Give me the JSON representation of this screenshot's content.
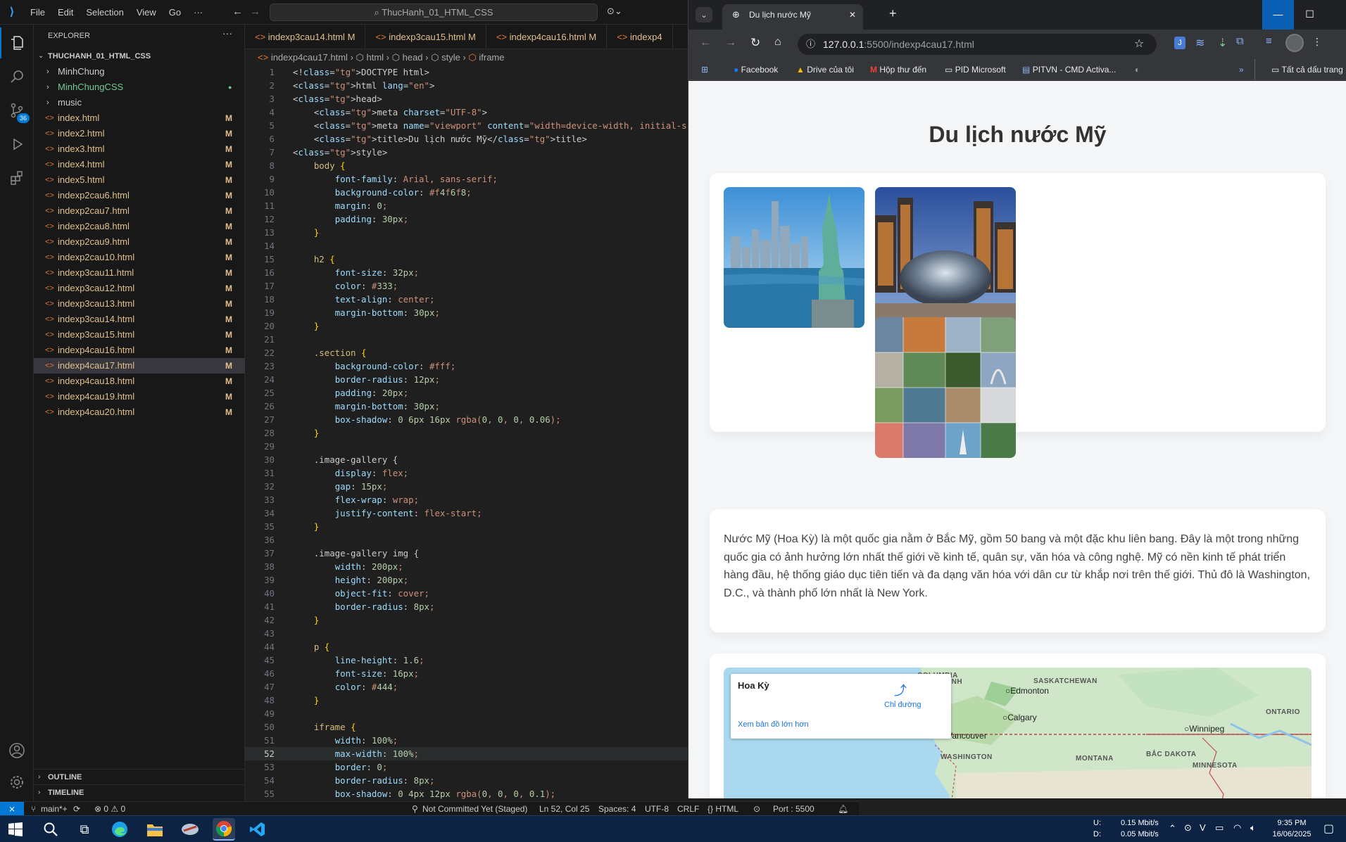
{
  "vscode": {
    "menu": [
      "File",
      "Edit",
      "Selection",
      "View",
      "Go",
      "···"
    ],
    "command_center": "ThucHanh_01_HTML_CSS",
    "explorer_title": "EXPLORER",
    "workspace": "THUCHANH_01_HTML_CSS",
    "folders": [
      {
        "name": "MinhChung",
        "color": "#cccccc"
      },
      {
        "name": "MinhChungCSS",
        "color": "#73c991"
      },
      {
        "name": "music",
        "color": "#cccccc"
      }
    ],
    "files": [
      {
        "name": "index.html",
        "status": "M"
      },
      {
        "name": "index2.html",
        "status": "M"
      },
      {
        "name": "index3.html",
        "status": "M"
      },
      {
        "name": "index4.html",
        "status": "M"
      },
      {
        "name": "index5.html",
        "status": "M"
      },
      {
        "name": "indexp2cau6.html",
        "status": "M"
      },
      {
        "name": "indexp2cau7.html",
        "status": "M"
      },
      {
        "name": "indexp2cau8.html",
        "status": "M"
      },
      {
        "name": "indexp2cau9.html",
        "status": "M"
      },
      {
        "name": "indexp2cau10.html",
        "status": "M"
      },
      {
        "name": "indexp3cau11.html",
        "status": "M"
      },
      {
        "name": "indexp3cau12.html",
        "status": "M"
      },
      {
        "name": "indexp3cau13.html",
        "status": "M"
      },
      {
        "name": "indexp3cau14.html",
        "status": "M"
      },
      {
        "name": "indexp3cau15.html",
        "status": "M"
      },
      {
        "name": "indexp4cau16.html",
        "status": "M"
      },
      {
        "name": "indexp4cau17.html",
        "status": "M"
      },
      {
        "name": "indexp4cau18.html",
        "status": "M"
      },
      {
        "name": "indexp4cau19.html",
        "status": "M"
      },
      {
        "name": "indexp4cau20.html",
        "status": "M"
      }
    ],
    "outline_label": "OUTLINE",
    "timeline_label": "TIMELINE",
    "source_control_badge": "36",
    "tabs": [
      {
        "name": "indexp3cau14.html",
        "status": "M"
      },
      {
        "name": "indexp3cau15.html",
        "status": "M"
      },
      {
        "name": "indexp4cau16.html",
        "status": "M"
      },
      {
        "name": "indexp4",
        "status": ""
      }
    ],
    "breadcrumb": [
      "indexp4cau17.html",
      "html",
      "head",
      "style",
      "iframe"
    ],
    "code_lines": [
      [
        "<!DOCTYPE html>"
      ],
      [
        "<html lang=\"en\">"
      ],
      [
        "<head>"
      ],
      [
        "    <meta charset=\"UTF-8\">"
      ],
      [
        "    <meta name=\"viewport\" content=\"width=device-width, initial-scale=1.0\">"
      ],
      [
        "    <title>Du lịch nước Mỹ</title>"
      ],
      [
        "<style>"
      ],
      [
        "    body {"
      ],
      [
        "        font-family: Arial, sans-serif;"
      ],
      [
        "        background-color: #f4f6f8;"
      ],
      [
        "        margin: 0;"
      ],
      [
        "        padding: 30px;"
      ],
      [
        "    }"
      ],
      [
        ""
      ],
      [
        "    h2 {"
      ],
      [
        "        font-size: 32px;"
      ],
      [
        "        color: #333;"
      ],
      [
        "        text-align: center;"
      ],
      [
        "        margin-bottom: 30px;"
      ],
      [
        "    }"
      ],
      [
        ""
      ],
      [
        "    .section {"
      ],
      [
        "        background-color: #fff;"
      ],
      [
        "        border-radius: 12px;"
      ],
      [
        "        padding: 20px;"
      ],
      [
        "        margin-bottom: 30px;"
      ],
      [
        "        box-shadow: 0 6px 16px rgba(0, 0, 0, 0.06);"
      ],
      [
        "    }"
      ],
      [
        ""
      ],
      [
        "    .image-gallery {"
      ],
      [
        "        display: flex;"
      ],
      [
        "        gap: 15px;"
      ],
      [
        "        flex-wrap: wrap;"
      ],
      [
        "        justify-content: flex-start;"
      ],
      [
        "    }"
      ],
      [
        ""
      ],
      [
        "    .image-gallery img {"
      ],
      [
        "        width: 200px;"
      ],
      [
        "        height: 200px;"
      ],
      [
        "        object-fit: cover;"
      ],
      [
        "        border-radius: 8px;"
      ],
      [
        "    }"
      ],
      [
        ""
      ],
      [
        "    p {"
      ],
      [
        "        line-height: 1.6;"
      ],
      [
        "        font-size: 16px;"
      ],
      [
        "        color: #444;"
      ],
      [
        "    }"
      ],
      [
        ""
      ],
      [
        "    iframe {"
      ],
      [
        "        width: 100%;"
      ],
      [
        "        max-width: 100%;"
      ],
      [
        "        border: 0;"
      ],
      [
        "        border-radius: 8px;"
      ],
      [
        "        box-shadow: 0 4px 12px rgba(0, 0, 0, 0.1);"
      ]
    ],
    "status": {
      "branch": "main*+",
      "problems": "⊗ 0 ⚠ 0",
      "commit": "Not Committed Yet (Staged)",
      "position": "Ln 52, Col 25",
      "spaces": "Spaces: 4",
      "encoding": "UTF-8",
      "eol": "CRLF",
      "language": "{} HTML",
      "port": "Port : 5500"
    }
  },
  "browser": {
    "tab_title": "Du lịch nước Mỹ",
    "url_host": "127.0.0.1",
    "url_rest": ":5500/indexp4cau17.html",
    "bookmarks": [
      "Facebook",
      "Drive của tôi",
      "Hộp thư đến",
      "PID Microsoft",
      "PITVN - CMD Activa..."
    ],
    "all_bookmarks": "Tất cả dấu trang",
    "page": {
      "heading": "Du lịch nước Mỹ",
      "paragraph": "Nước Mỹ (Hoa Kỳ) là một quốc gia nằm ở Bắc Mỹ, gồm 50 bang và một đặc khu liên bang. Đây là một trong những quốc gia có ảnh hưởng lớn nhất thế giới về kinh tế, quân sự, văn hóa và công nghệ. Mỹ có nền kinh tế phát triển hàng đầu, hệ thống giáo dục tiên tiến và đa dạng văn hóa với dân cư từ khắp nơi trên thế giới. Thủ đô là Washington, D.C., và thành phố lớn nhất là New York.",
      "map": {
        "place": "Hoa Kỳ",
        "directions": "Chỉ đường",
        "larger_map": "Xem bản đồ lớn hơn",
        "regions": [
          "COLUMBIA",
          "THUỘC ANH",
          "SASKATCHEWAN",
          "ONTARIO",
          "WASHINGTON",
          "MONTANA",
          "BẮC DAKOTA",
          "MINNESOTA"
        ],
        "cities": [
          "Edmonton",
          "Calgary",
          "Vancouver",
          "Winnipeg"
        ]
      }
    }
  },
  "taskbar": {
    "net_u_label": "U:",
    "net_d_label": "D:",
    "net_up": "0.15 Mbit/s",
    "net_down": "0.05 Mbit/s",
    "time": "9:35 PM",
    "date": "16/06/2025"
  }
}
